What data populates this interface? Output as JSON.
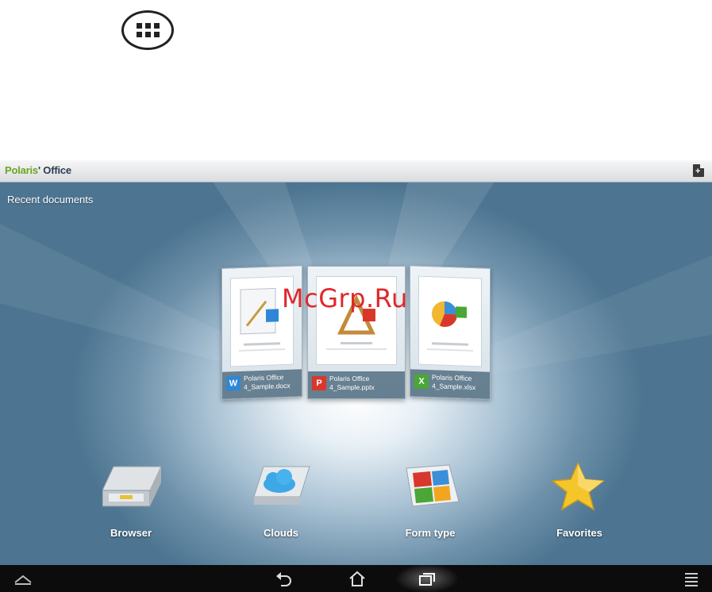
{
  "app": {
    "title_part1": "Polaris",
    "title_part2": "Office",
    "section_label": "Recent documents"
  },
  "recent_documents": [
    {
      "name": "Polaris Office 4_Sample.docx",
      "type": "docx",
      "color": "#2f86d6"
    },
    {
      "name": "Polaris Office 4_Sample.pptx",
      "type": "pptx",
      "color": "#d8382c"
    },
    {
      "name": "Polaris Office 4_Sample.xlsx",
      "type": "xlsx",
      "color": "#49a637"
    }
  ],
  "shortcuts": [
    {
      "label": "Browser",
      "icon": "drawer-icon"
    },
    {
      "label": "Clouds",
      "icon": "cloud-icon"
    },
    {
      "label": "Form type",
      "icon": "form-grid-icon"
    },
    {
      "label": "Favorites",
      "icon": "star-icon"
    }
  ],
  "watermark": "McGrp.Ru",
  "nav": {
    "icons": [
      "home-up-icon",
      "back-icon",
      "home-icon",
      "recent-apps-icon",
      "menu-icon"
    ]
  }
}
